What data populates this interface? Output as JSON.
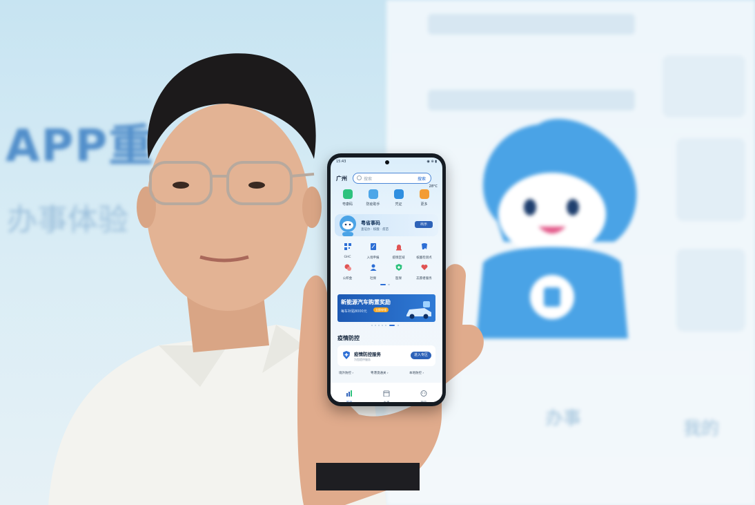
{
  "photo": {
    "background_text": {
      "app_title": "APP重",
      "subtitle": "办事体验"
    },
    "background_labels": [
      "办事",
      "我的"
    ]
  },
  "phone": {
    "status": {
      "time": "15:43",
      "icons": "◉ ⊕ ▮"
    },
    "top": {
      "city": "广州",
      "search_placeholder": "搜索",
      "search_button": "搜索",
      "temperature": "28°C"
    },
    "quick_actions": [
      {
        "label": "粤康码",
        "color": "#2ec27e"
      },
      {
        "label": "防疫助手",
        "color": "#4da6e8"
      },
      {
        "label": "凭证",
        "color": "#2f8fe0"
      },
      {
        "label": "更多",
        "color": "#f39c34"
      }
    ],
    "banner": {
      "title": "粤省事码",
      "subtitle": "查证办 · 核酸 · 疫苗",
      "cta": "出示"
    },
    "grid": [
      {
        "label": "GHC",
        "color": "#2c6ed5"
      },
      {
        "label": "入境申报",
        "color": "#2c6ed5"
      },
      {
        "label": "疫情区域",
        "color": "#e05454"
      },
      {
        "label": "核酸检测点",
        "color": "#2c6ed5"
      },
      {
        "label": "公积金",
        "color": "#e05454"
      },
      {
        "label": "社保",
        "color": "#2c6ed5"
      },
      {
        "label": "医保",
        "color": "#2ec27e"
      },
      {
        "label": "志愿者服务",
        "color": "#e05454"
      }
    ],
    "ad": {
      "title": "新能源汽车购置奖励",
      "line2": "每车补贴8000元",
      "pill": "立即申领"
    },
    "section": {
      "title": "疫情防控"
    },
    "card": {
      "title": "疫情防控服务",
      "subtitle": "为您提供服务",
      "cta": "进入专区"
    },
    "links": [
      "境外防控 ›",
      "粤港澳通关 ›",
      "本地防控 ›"
    ],
    "tabs": [
      {
        "label": "首页",
        "active": true
      },
      {
        "label": "办事",
        "active": false
      },
      {
        "label": "我的",
        "active": false
      }
    ]
  }
}
